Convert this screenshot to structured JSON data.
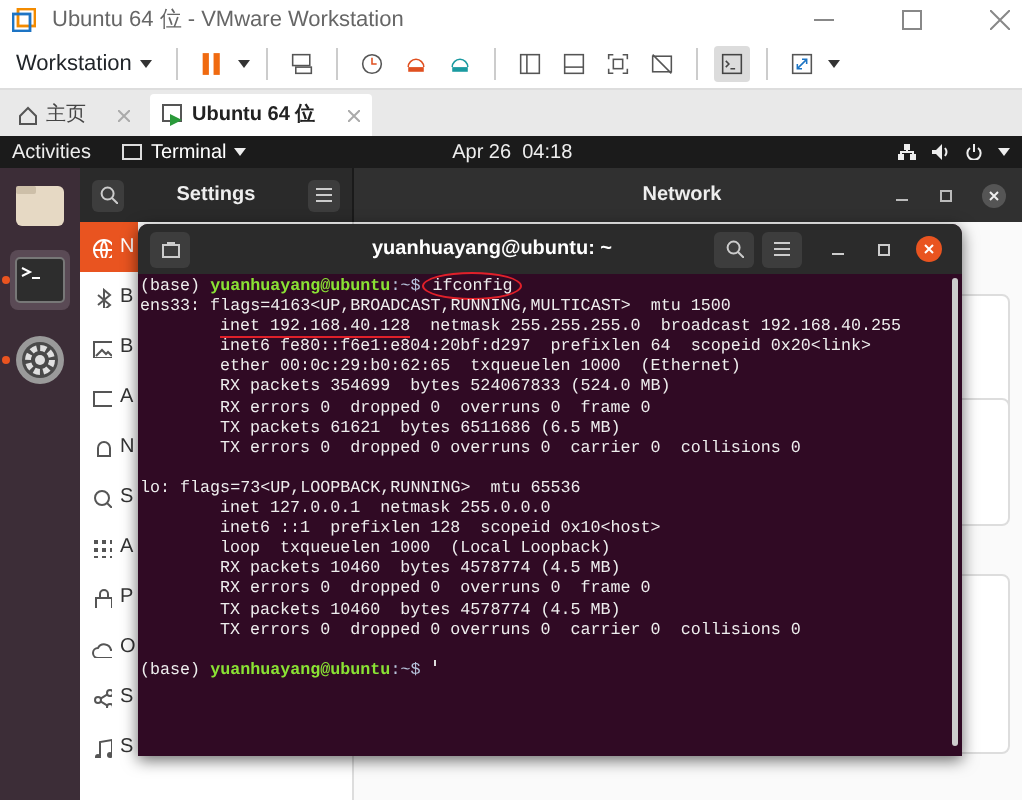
{
  "window": {
    "title": "Ubuntu 64 位 - VMware Workstation"
  },
  "toolbar": {
    "menu": "Workstation",
    "buttons": [
      {
        "kind": "pause",
        "selected": false
      },
      {
        "kind": "send-keys",
        "selected": false
      },
      {
        "kind": "snapshot",
        "selected": false
      },
      {
        "kind": "restore",
        "selected": false
      },
      {
        "kind": "manage",
        "selected": false
      },
      {
        "kind": "library",
        "selected": false
      },
      {
        "kind": "thumbnail",
        "selected": false
      },
      {
        "kind": "fullscreen",
        "selected": false
      },
      {
        "kind": "unity",
        "selected": false
      },
      {
        "kind": "console",
        "selected": true
      },
      {
        "kind": "stretch",
        "selected": false
      }
    ]
  },
  "tabs": [
    {
      "label": "主页",
      "kind": "home",
      "selected": false
    },
    {
      "label": "Ubuntu 64 位",
      "kind": "vm",
      "selected": true
    }
  ],
  "top_bar": {
    "activities": "Activities",
    "app_menu": "Terminal",
    "clock": "Apr 26  04:18"
  },
  "dock": [
    {
      "kind": "files",
      "selected": false,
      "running": false
    },
    {
      "kind": "terminal",
      "selected": true,
      "running": true
    },
    {
      "kind": "settings",
      "selected": false,
      "running": true
    }
  ],
  "settings": {
    "title": "Settings",
    "panel_title": "Network",
    "sidebar": [
      {
        "kind": "network",
        "label": "N",
        "selected": true
      },
      {
        "kind": "bluetooth",
        "label": "B",
        "selected": false
      },
      {
        "kind": "background",
        "label": "B",
        "selected": false
      },
      {
        "kind": "appearance",
        "label": "A",
        "selected": false
      },
      {
        "kind": "notifications",
        "label": "N",
        "selected": false
      },
      {
        "kind": "search",
        "label": "S",
        "selected": false
      },
      {
        "kind": "applications",
        "label": "A",
        "selected": false
      },
      {
        "kind": "privacy",
        "label": "P",
        "selected": false
      },
      {
        "kind": "online",
        "label": "O",
        "selected": false
      },
      {
        "kind": "sharing",
        "label": "S",
        "selected": false
      },
      {
        "kind": "sound",
        "label": "S",
        "selected": false
      }
    ]
  },
  "terminal": {
    "title": "yuanhuayang@ubuntu: ~",
    "lines": [
      {
        "kind": "prompt",
        "env": "(base)",
        "user": "yuanhuayang@ubuntu",
        "path": ":~$",
        "command": "ifconfig",
        "circled": true
      },
      {
        "kind": "output",
        "indented": false,
        "text": "ens33: flags=4163<UP,BROADCAST,RUNNING,MULTICAST>  mtu 1500"
      },
      {
        "kind": "output",
        "indented": true,
        "parts": [
          {
            "text": "inet 192.168.40.128",
            "underlined": true
          },
          {
            "text": "  netmask 255.255.255.0  broadcast 192.168.40.255",
            "underlined": false
          }
        ]
      },
      {
        "kind": "output",
        "indented": true,
        "text": "inet6 fe80::f6e1:e804:20bf:d297  prefixlen 64  scopeid 0x20<link>"
      },
      {
        "kind": "output",
        "indented": true,
        "text": "ether 00:0c:29:b0:62:65  txqueuelen 1000  (Ethernet)"
      },
      {
        "kind": "output",
        "indented": true,
        "text": "RX packets 354699  bytes 524067833 (524.0 MB)"
      },
      {
        "kind": "output",
        "indented": true,
        "text": "RX errors 0  dropped 0  overruns 0  frame 0"
      },
      {
        "kind": "output",
        "indented": true,
        "text": "TX packets 61621  bytes 6511686 (6.5 MB)"
      },
      {
        "kind": "output",
        "indented": true,
        "text": "TX errors 0  dropped 0 overruns 0  carrier 0  collisions 0"
      },
      {
        "kind": "blank"
      },
      {
        "kind": "output",
        "indented": false,
        "text": "lo: flags=73<UP,LOOPBACK,RUNNING>  mtu 65536"
      },
      {
        "kind": "output",
        "indented": true,
        "text": "inet 127.0.0.1  netmask 255.0.0.0"
      },
      {
        "kind": "output",
        "indented": true,
        "text": "inet6 ::1  prefixlen 128  scopeid 0x10<host>"
      },
      {
        "kind": "output",
        "indented": true,
        "text": "loop  txqueuelen 1000  (Local Loopback)"
      },
      {
        "kind": "output",
        "indented": true,
        "text": "RX packets 10460  bytes 4578774 (4.5 MB)"
      },
      {
        "kind": "output",
        "indented": true,
        "text": "RX errors 0  dropped 0  overruns 0  frame 0"
      },
      {
        "kind": "output",
        "indented": true,
        "text": "TX packets 10460  bytes 4578774 (4.5 MB)"
      },
      {
        "kind": "output",
        "indented": true,
        "text": "TX errors 0  dropped 0 overruns 0  carrier 0  collisions 0"
      },
      {
        "kind": "blank"
      },
      {
        "kind": "prompt",
        "env": "(base)",
        "user": "yuanhuayang@ubuntu",
        "path": ":~$",
        "circled": false
      }
    ]
  }
}
